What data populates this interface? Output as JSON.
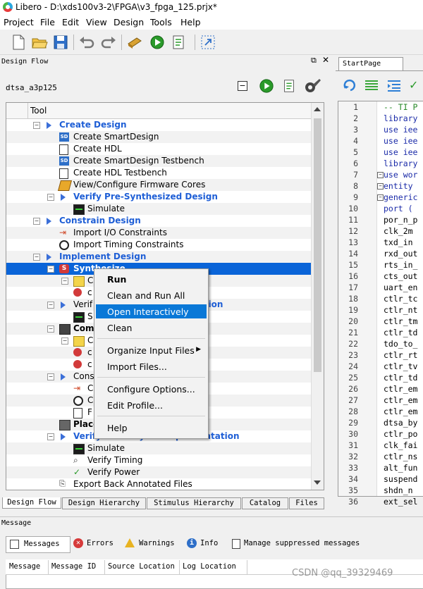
{
  "window": {
    "title": "Libero - D:\\xds100v3-2\\FPGA\\v3_fpga_125.prjx*"
  },
  "menu": [
    "Project",
    "File",
    "Edit",
    "View",
    "Design",
    "Tools",
    "Help"
  ],
  "design_flow": {
    "panel_title": "Design Flow",
    "device": "dtsa_a3p125",
    "column_header": "Tool",
    "rows": [
      {
        "label": "Create Design",
        "header": true
      },
      {
        "label": "Create SmartDesign"
      },
      {
        "label": "Create HDL"
      },
      {
        "label": "Create SmartDesign Testbench"
      },
      {
        "label": "Create HDL Testbench"
      },
      {
        "label": "View/Configure Firmware Cores"
      },
      {
        "label": "Verify Pre-Synthesized Design",
        "header": true
      },
      {
        "label": "Simulate"
      },
      {
        "label": "Constrain Design",
        "header": true
      },
      {
        "label": "Import I/O Constraints"
      },
      {
        "label": "Import Timing Constraints"
      },
      {
        "label": "Implement Design",
        "header": true
      },
      {
        "label": "Synthesize"
      },
      {
        "label": "C"
      },
      {
        "label": "c"
      },
      {
        "label": "Verif",
        "tail": "tation"
      },
      {
        "label": "S"
      },
      {
        "label": "Com"
      },
      {
        "label": "C"
      },
      {
        "label": "c"
      },
      {
        "label": "c"
      },
      {
        "label": "Cons"
      },
      {
        "label": "C"
      },
      {
        "label": "C"
      },
      {
        "label": "F"
      },
      {
        "label": "Place"
      },
      {
        "label": "Verify Post Layout Implementation",
        "header": true
      },
      {
        "label": "Simulate"
      },
      {
        "label": "Verify Timing"
      },
      {
        "label": "Verify Power"
      },
      {
        "label": "Export Back Annotated Files"
      }
    ]
  },
  "context_menu": {
    "run": "Run",
    "clean_run_all": "Clean and Run All",
    "open_interactively": "Open Interactively",
    "clean": "Clean",
    "organize_input_files": "Organize Input Files",
    "import_files": "Import Files...",
    "configure_options": "Configure Options...",
    "edit_profile": "Edit Profile...",
    "help": "Help"
  },
  "right_panel": {
    "tab": "StartPage",
    "code": [
      {
        "n": "1",
        "t": "-- TI P"
      },
      {
        "n": "2",
        "t": "library"
      },
      {
        "n": "3",
        "t": "use iee"
      },
      {
        "n": "4",
        "t": "use iee"
      },
      {
        "n": "5",
        "t": "use iee"
      },
      {
        "n": "6",
        "t": "library"
      },
      {
        "n": "7",
        "t": "use wor"
      },
      {
        "n": "8",
        "t": "entity "
      },
      {
        "n": "9",
        "t": "generic"
      },
      {
        "n": "10",
        "t": "port ("
      },
      {
        "n": "11",
        "t": "por_n_p"
      },
      {
        "n": "12",
        "t": "clk_2m"
      },
      {
        "n": "13",
        "t": "txd_in"
      },
      {
        "n": "14",
        "t": "rxd_out"
      },
      {
        "n": "15",
        "t": "rts_in_"
      },
      {
        "n": "16",
        "t": "cts_out"
      },
      {
        "n": "17",
        "t": "uart_en"
      },
      {
        "n": "18",
        "t": "ctlr_tc"
      },
      {
        "n": "19",
        "t": "ctlr_nt"
      },
      {
        "n": "20",
        "t": "ctlr_tm"
      },
      {
        "n": "21",
        "t": "ctlr_td"
      },
      {
        "n": "22",
        "t": "tdo_to_"
      },
      {
        "n": "23",
        "t": "ctlr_rt"
      },
      {
        "n": "24",
        "t": "ctlr_tv"
      },
      {
        "n": "25",
        "t": "ctlr_td"
      },
      {
        "n": "26",
        "t": "ctlr_em"
      },
      {
        "n": "27",
        "t": "ctlr_em"
      },
      {
        "n": "28",
        "t": "ctlr_em"
      },
      {
        "n": "29",
        "t": "dtsa_by"
      },
      {
        "n": "30",
        "t": "ctlr_po"
      },
      {
        "n": "31",
        "t": "clk_fai"
      },
      {
        "n": "32",
        "t": "ctlr_ns"
      },
      {
        "n": "33",
        "t": "alt_fun"
      },
      {
        "n": "34",
        "t": "suspend"
      },
      {
        "n": "35",
        "t": "shdn_n"
      },
      {
        "n": "36",
        "t": "ext_sel"
      }
    ]
  },
  "bottom_tabs": [
    "Design Flow",
    "Design Hierarchy",
    "Stimulus Hierarchy",
    "Catalog",
    "Files"
  ],
  "messages": {
    "title": "Message",
    "buttons": [
      "Messages",
      "Errors",
      "Warnings",
      "Info",
      "Manage suppressed messages"
    ],
    "columns": [
      "Message",
      "Message ID",
      "Source Location",
      "Log Location"
    ]
  },
  "watermark": "CSDN @qq_39329469"
}
